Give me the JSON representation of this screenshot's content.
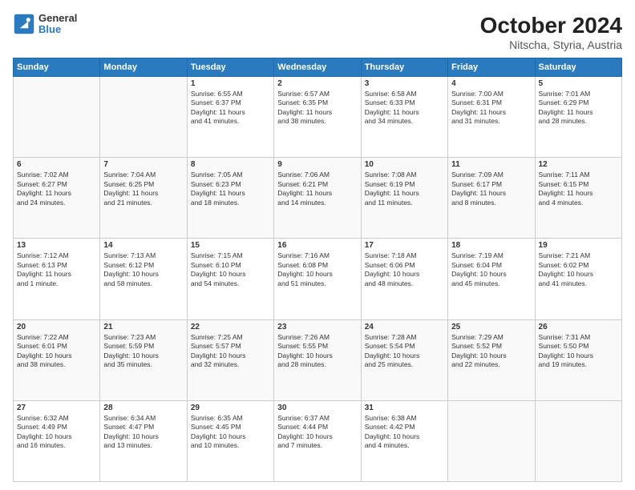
{
  "header": {
    "logo_general": "General",
    "logo_blue": "Blue",
    "title": "October 2024",
    "subtitle": "Nitscha, Styria, Austria"
  },
  "weekdays": [
    "Sunday",
    "Monday",
    "Tuesday",
    "Wednesday",
    "Thursday",
    "Friday",
    "Saturday"
  ],
  "weeks": [
    [
      {
        "day": null,
        "info": null
      },
      {
        "day": null,
        "info": null
      },
      {
        "day": "1",
        "info": "Sunrise: 6:55 AM\nSunset: 6:37 PM\nDaylight: 11 hours\nand 41 minutes."
      },
      {
        "day": "2",
        "info": "Sunrise: 6:57 AM\nSunset: 6:35 PM\nDaylight: 11 hours\nand 38 minutes."
      },
      {
        "day": "3",
        "info": "Sunrise: 6:58 AM\nSunset: 6:33 PM\nDaylight: 11 hours\nand 34 minutes."
      },
      {
        "day": "4",
        "info": "Sunrise: 7:00 AM\nSunset: 6:31 PM\nDaylight: 11 hours\nand 31 minutes."
      },
      {
        "day": "5",
        "info": "Sunrise: 7:01 AM\nSunset: 6:29 PM\nDaylight: 11 hours\nand 28 minutes."
      }
    ],
    [
      {
        "day": "6",
        "info": "Sunrise: 7:02 AM\nSunset: 6:27 PM\nDaylight: 11 hours\nand 24 minutes."
      },
      {
        "day": "7",
        "info": "Sunrise: 7:04 AM\nSunset: 6:25 PM\nDaylight: 11 hours\nand 21 minutes."
      },
      {
        "day": "8",
        "info": "Sunrise: 7:05 AM\nSunset: 6:23 PM\nDaylight: 11 hours\nand 18 minutes."
      },
      {
        "day": "9",
        "info": "Sunrise: 7:06 AM\nSunset: 6:21 PM\nDaylight: 11 hours\nand 14 minutes."
      },
      {
        "day": "10",
        "info": "Sunrise: 7:08 AM\nSunset: 6:19 PM\nDaylight: 11 hours\nand 11 minutes."
      },
      {
        "day": "11",
        "info": "Sunrise: 7:09 AM\nSunset: 6:17 PM\nDaylight: 11 hours\nand 8 minutes."
      },
      {
        "day": "12",
        "info": "Sunrise: 7:11 AM\nSunset: 6:15 PM\nDaylight: 11 hours\nand 4 minutes."
      }
    ],
    [
      {
        "day": "13",
        "info": "Sunrise: 7:12 AM\nSunset: 6:13 PM\nDaylight: 11 hours\nand 1 minute."
      },
      {
        "day": "14",
        "info": "Sunrise: 7:13 AM\nSunset: 6:12 PM\nDaylight: 10 hours\nand 58 minutes."
      },
      {
        "day": "15",
        "info": "Sunrise: 7:15 AM\nSunset: 6:10 PM\nDaylight: 10 hours\nand 54 minutes."
      },
      {
        "day": "16",
        "info": "Sunrise: 7:16 AM\nSunset: 6:08 PM\nDaylight: 10 hours\nand 51 minutes."
      },
      {
        "day": "17",
        "info": "Sunrise: 7:18 AM\nSunset: 6:06 PM\nDaylight: 10 hours\nand 48 minutes."
      },
      {
        "day": "18",
        "info": "Sunrise: 7:19 AM\nSunset: 6:04 PM\nDaylight: 10 hours\nand 45 minutes."
      },
      {
        "day": "19",
        "info": "Sunrise: 7:21 AM\nSunset: 6:02 PM\nDaylight: 10 hours\nand 41 minutes."
      }
    ],
    [
      {
        "day": "20",
        "info": "Sunrise: 7:22 AM\nSunset: 6:01 PM\nDaylight: 10 hours\nand 38 minutes."
      },
      {
        "day": "21",
        "info": "Sunrise: 7:23 AM\nSunset: 5:59 PM\nDaylight: 10 hours\nand 35 minutes."
      },
      {
        "day": "22",
        "info": "Sunrise: 7:25 AM\nSunset: 5:57 PM\nDaylight: 10 hours\nand 32 minutes."
      },
      {
        "day": "23",
        "info": "Sunrise: 7:26 AM\nSunset: 5:55 PM\nDaylight: 10 hours\nand 28 minutes."
      },
      {
        "day": "24",
        "info": "Sunrise: 7:28 AM\nSunset: 5:54 PM\nDaylight: 10 hours\nand 25 minutes."
      },
      {
        "day": "25",
        "info": "Sunrise: 7:29 AM\nSunset: 5:52 PM\nDaylight: 10 hours\nand 22 minutes."
      },
      {
        "day": "26",
        "info": "Sunrise: 7:31 AM\nSunset: 5:50 PM\nDaylight: 10 hours\nand 19 minutes."
      }
    ],
    [
      {
        "day": "27",
        "info": "Sunrise: 6:32 AM\nSunset: 4:49 PM\nDaylight: 10 hours\nand 16 minutes."
      },
      {
        "day": "28",
        "info": "Sunrise: 6:34 AM\nSunset: 4:47 PM\nDaylight: 10 hours\nand 13 minutes."
      },
      {
        "day": "29",
        "info": "Sunrise: 6:35 AM\nSunset: 4:45 PM\nDaylight: 10 hours\nand 10 minutes."
      },
      {
        "day": "30",
        "info": "Sunrise: 6:37 AM\nSunset: 4:44 PM\nDaylight: 10 hours\nand 7 minutes."
      },
      {
        "day": "31",
        "info": "Sunrise: 6:38 AM\nSunset: 4:42 PM\nDaylight: 10 hours\nand 4 minutes."
      },
      {
        "day": null,
        "info": null
      },
      {
        "day": null,
        "info": null
      }
    ]
  ]
}
